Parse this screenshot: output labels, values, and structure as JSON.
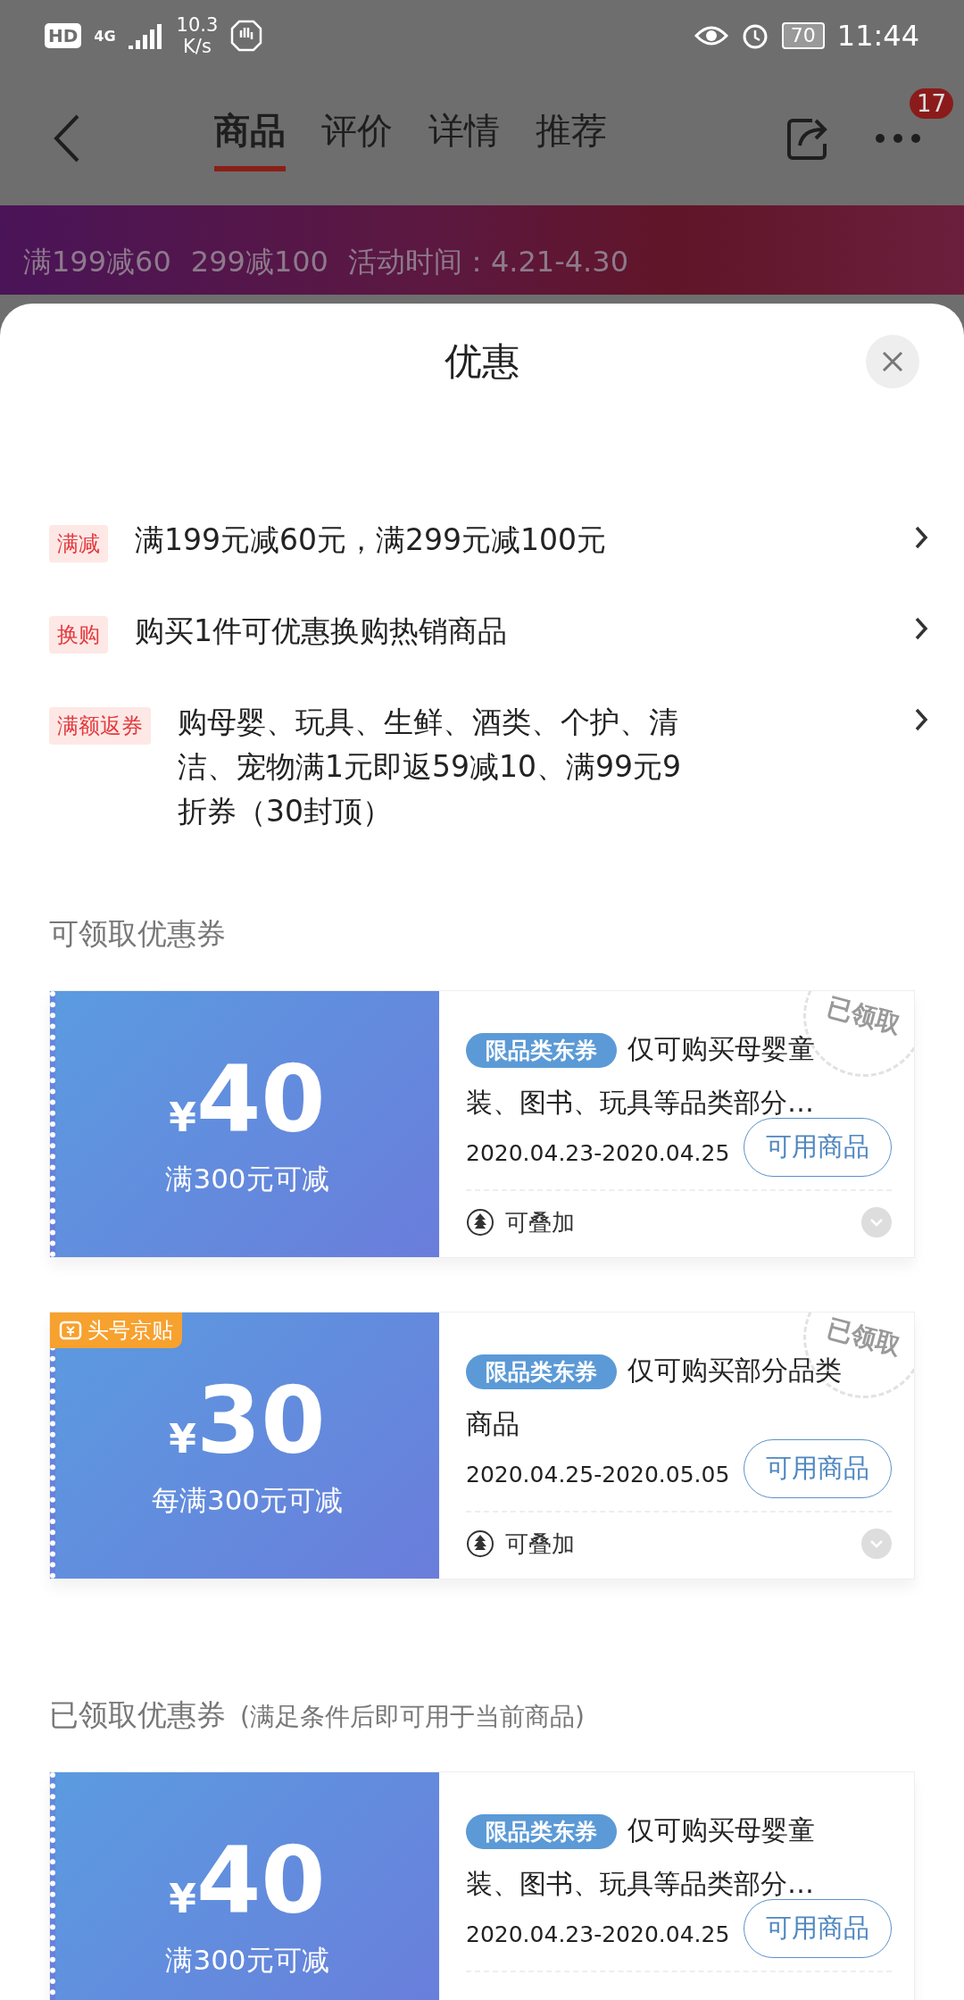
{
  "status_bar": {
    "hd": "HD",
    "network": "4G",
    "speed": "10.3",
    "speed_unit": "K/s",
    "battery": "70",
    "time": "11:44"
  },
  "nav": {
    "tabs": [
      {
        "label": "商品",
        "selected": true
      },
      {
        "label": "评价",
        "selected": false
      },
      {
        "label": "详情",
        "selected": false
      },
      {
        "label": "推荐",
        "selected": false
      }
    ],
    "more_badge": "17"
  },
  "banner": {
    "offers": [
      "满199减60",
      "299减100",
      "活动时间：4.21-4.30"
    ]
  },
  "sheet": {
    "title": "优惠",
    "promotions": [
      {
        "tag": "满减",
        "text": "满199元减60元，满299元减100元"
      },
      {
        "tag": "换购",
        "text": "购买1件可优惠换购热销商品"
      },
      {
        "tag": "满额返券",
        "text": "购母婴、玩具、生鲜、酒类、个护、清洁、宠物满1元即返59减10、满99元9折券（30封顶）"
      }
    ],
    "sections": [
      {
        "title": "可领取优惠券",
        "coupons": [
          {
            "currency": "¥",
            "amount": "40",
            "condition": "满300元可减",
            "tag": "限品类东券",
            "description": "仅可购买母婴童装、图书、玩具等品类部分…",
            "validity": "2020.04.23-2020.04.25",
            "button": "可用商品",
            "stackable": "可叠加",
            "stamp": "已领取"
          },
          {
            "corner_label": "头号京贴",
            "currency": "¥",
            "amount": "30",
            "condition": "每满300元可减",
            "tag": "限品类东券",
            "description": "仅可购买部分品类商品",
            "validity": "2020.04.25-2020.05.05",
            "button": "可用商品",
            "stackable": "可叠加",
            "stamp": "已领取"
          }
        ]
      },
      {
        "title": "已领取优惠券",
        "note": "(满足条件后即可用于当前商品)",
        "coupons": [
          {
            "currency": "¥",
            "amount": "40",
            "condition": "满300元可减",
            "tag": "限品类东券",
            "description": "仅可购买母婴童装、图书、玩具等品类部分…",
            "validity": "2020.04.23-2020.04.25",
            "button": "可用商品"
          }
        ]
      }
    ]
  }
}
